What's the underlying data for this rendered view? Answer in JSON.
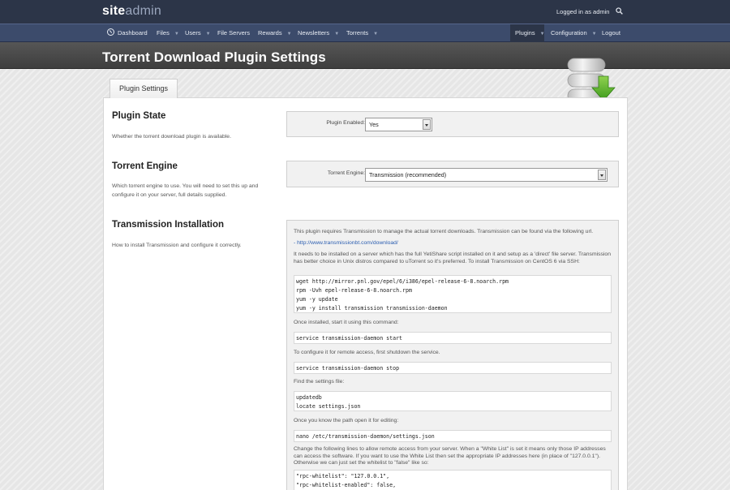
{
  "brand": {
    "site": "site",
    "admin": "admin"
  },
  "header": {
    "logged_in_text": "Logged in as admin"
  },
  "nav": {
    "dashboard": "Dashboard",
    "files": "Files",
    "users": "Users",
    "file_servers": "File Servers",
    "rewards": "Rewards",
    "newsletters": "Newsletters",
    "torrents": "Torrents",
    "plugins": "Plugins",
    "configuration": "Configuration",
    "logout": "Logout",
    "caret": "▼"
  },
  "page": {
    "title": "Torrent Download Plugin Settings",
    "tab": "Plugin Settings"
  },
  "sections": {
    "state": {
      "title": "Plugin State",
      "desc": "Whether the torrent download plugin is available.",
      "label": "Plugin Enabled:",
      "value": "Yes"
    },
    "engine": {
      "title": "Torrent Engine",
      "desc": "Which torrent engine to use. You will need to set this up and configure it on your server, full details supplied.",
      "label": "Torrent Engine:",
      "value": "Transmission (recommended)"
    },
    "install": {
      "title": "Transmission Installation",
      "desc": "How to install Transmission and configure it correctly.",
      "p1": "This plugin requires Transmission to manage the actual torrent downloads. Transmission can be found via the following url.",
      "link": "- http://www.transmissionbt.com/download/",
      "p2": "It needs to be installed on a server which has the full YetiShare script installed on it and setup as a 'direct' file server. Transmission has better choice in Unix distros compared to uTorrent so it's preferred. To install Transmission on CentOS 6 via SSH:",
      "code1": [
        "wget http://mirror.pnl.gov/epel/6/i386/epel-release-6-8.noarch.rpm",
        "rpm -Uvh epel-release-6-8.noarch.rpm",
        "yum -y update",
        "yum -y install transmission transmission-daemon"
      ],
      "p3": "Once installed, start it using this command:",
      "code2": "service transmission-daemon start",
      "p4": "To configure it for remote access, first shutdown the service.",
      "code3": "service transmission-daemon stop",
      "p5": "Find the settings file:",
      "code4": [
        "updatedb",
        "locate settings.json"
      ],
      "p6": "Once you know the path open it for editing:",
      "code5": "nano /etc/transmission-daemon/settings.json",
      "p7": "Change the following lines to allow remote access from your server. When a \"White List\" is set it means only those IP addresses can access the software. If you want to use the White List then set the appropriate IP addresses here (in place of \"127.0.0.1\"). Otherwise we can just set the whitelist to \"false\" like so:",
      "code6": [
        "\"rpc-whitelist\": \"127.0.0.1\",",
        "\"rpc-whitelist-enabled\": false,"
      ]
    }
  }
}
